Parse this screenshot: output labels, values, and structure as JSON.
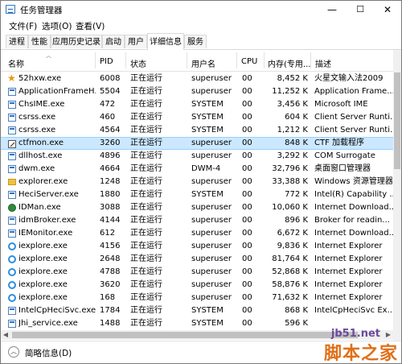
{
  "window": {
    "title": "任务管理器",
    "minimize_glyph": "—",
    "maximize_glyph": "☐",
    "close_glyph": "✕"
  },
  "menu": [
    "文件(F)",
    "选项(O)",
    "查看(V)"
  ],
  "tabs": [
    {
      "label": "进程",
      "active": false
    },
    {
      "label": "性能",
      "active": false
    },
    {
      "label": "应用历史记录",
      "active": false
    },
    {
      "label": "启动",
      "active": false
    },
    {
      "label": "用户",
      "active": false
    },
    {
      "label": "详细信息",
      "active": true
    },
    {
      "label": "服务",
      "active": false
    }
  ],
  "columns": [
    "名称",
    "PID",
    "状态",
    "用户名",
    "CPU",
    "内存(专用...",
    "描述"
  ],
  "rows": [
    {
      "icon": "star",
      "name": "52hxw.exe",
      "pid": "6008",
      "status": "正在运行",
      "user": "superuser",
      "cpu": "00",
      "mem": "8,452 K",
      "desc": "火星文输入法2009"
    },
    {
      "icon": "win",
      "name": "ApplicationFrameH...",
      "pid": "5504",
      "status": "正在运行",
      "user": "superuser",
      "cpu": "00",
      "mem": "11,252 K",
      "desc": "Application Frame..."
    },
    {
      "icon": "win",
      "name": "ChsIME.exe",
      "pid": "472",
      "status": "正在运行",
      "user": "SYSTEM",
      "cpu": "00",
      "mem": "3,456 K",
      "desc": "Microsoft IME"
    },
    {
      "icon": "win",
      "name": "csrss.exe",
      "pid": "460",
      "status": "正在运行",
      "user": "SYSTEM",
      "cpu": "00",
      "mem": "604 K",
      "desc": "Client Server Runti..."
    },
    {
      "icon": "win",
      "name": "csrss.exe",
      "pid": "4564",
      "status": "正在运行",
      "user": "SYSTEM",
      "cpu": "00",
      "mem": "1,212 K",
      "desc": "Client Server Runti..."
    },
    {
      "icon": "pen",
      "name": "ctfmon.exe",
      "pid": "3260",
      "status": "正在运行",
      "user": "superuser",
      "cpu": "00",
      "mem": "848 K",
      "desc": "CTF 加载程序",
      "selected": true
    },
    {
      "icon": "win",
      "name": "dllhost.exe",
      "pid": "4896",
      "status": "正在运行",
      "user": "superuser",
      "cpu": "00",
      "mem": "3,292 K",
      "desc": "COM Surrogate"
    },
    {
      "icon": "win",
      "name": "dwm.exe",
      "pid": "4664",
      "status": "正在运行",
      "user": "DWM-4",
      "cpu": "00",
      "mem": "32,796 K",
      "desc": "桌面窗口管理器"
    },
    {
      "icon": "folder",
      "name": "explorer.exe",
      "pid": "1248",
      "status": "正在运行",
      "user": "superuser",
      "cpu": "00",
      "mem": "33,388 K",
      "desc": "Windows 资源管理器"
    },
    {
      "icon": "win",
      "name": "HeciServer.exe",
      "pid": "1880",
      "status": "正在运行",
      "user": "SYSTEM",
      "cpu": "00",
      "mem": "772 K",
      "desc": "Intel(R) Capability ..."
    },
    {
      "icon": "idm",
      "name": "IDMan.exe",
      "pid": "3088",
      "status": "正在运行",
      "user": "superuser",
      "cpu": "00",
      "mem": "10,060 K",
      "desc": "Internet Download..."
    },
    {
      "icon": "win",
      "name": "idmBroker.exe",
      "pid": "4144",
      "status": "正在运行",
      "user": "superuser",
      "cpu": "00",
      "mem": "896 K",
      "desc": "Broker for readin..."
    },
    {
      "icon": "win",
      "name": "IEMonitor.exe",
      "pid": "612",
      "status": "正在运行",
      "user": "superuser",
      "cpu": "00",
      "mem": "6,672 K",
      "desc": "Internet Download..."
    },
    {
      "icon": "ie",
      "name": "iexplore.exe",
      "pid": "4156",
      "status": "正在运行",
      "user": "superuser",
      "cpu": "00",
      "mem": "9,836 K",
      "desc": "Internet Explorer"
    },
    {
      "icon": "ie",
      "name": "iexplore.exe",
      "pid": "2648",
      "status": "正在运行",
      "user": "superuser",
      "cpu": "00",
      "mem": "81,764 K",
      "desc": "Internet Explorer"
    },
    {
      "icon": "ie",
      "name": "iexplore.exe",
      "pid": "4788",
      "status": "正在运行",
      "user": "superuser",
      "cpu": "00",
      "mem": "52,868 K",
      "desc": "Internet Explorer"
    },
    {
      "icon": "ie",
      "name": "iexplore.exe",
      "pid": "3620",
      "status": "正在运行",
      "user": "superuser",
      "cpu": "00",
      "mem": "58,876 K",
      "desc": "Internet Explorer"
    },
    {
      "icon": "ie",
      "name": "iexplore.exe",
      "pid": "168",
      "status": "正在运行",
      "user": "superuser",
      "cpu": "00",
      "mem": "71,632 K",
      "desc": "Internet Explorer"
    },
    {
      "icon": "win",
      "name": "IntelCpHeciSvc.exe",
      "pid": "1784",
      "status": "正在运行",
      "user": "SYSTEM",
      "cpu": "00",
      "mem": "868 K",
      "desc": "IntelCpHeciSvc Ex..."
    },
    {
      "icon": "win",
      "name": "Jhi_service.exe",
      "pid": "1488",
      "status": "正在运行",
      "user": "SYSTEM",
      "cpu": "00",
      "mem": "596 K",
      "desc": ""
    }
  ],
  "footer": {
    "label": "简略信息(D)"
  },
  "watermark": {
    "site": "jb51.net",
    "brand": "脚本之家"
  },
  "colors": {
    "selected_row": "#cce8ff",
    "accent": "#0078d7"
  }
}
